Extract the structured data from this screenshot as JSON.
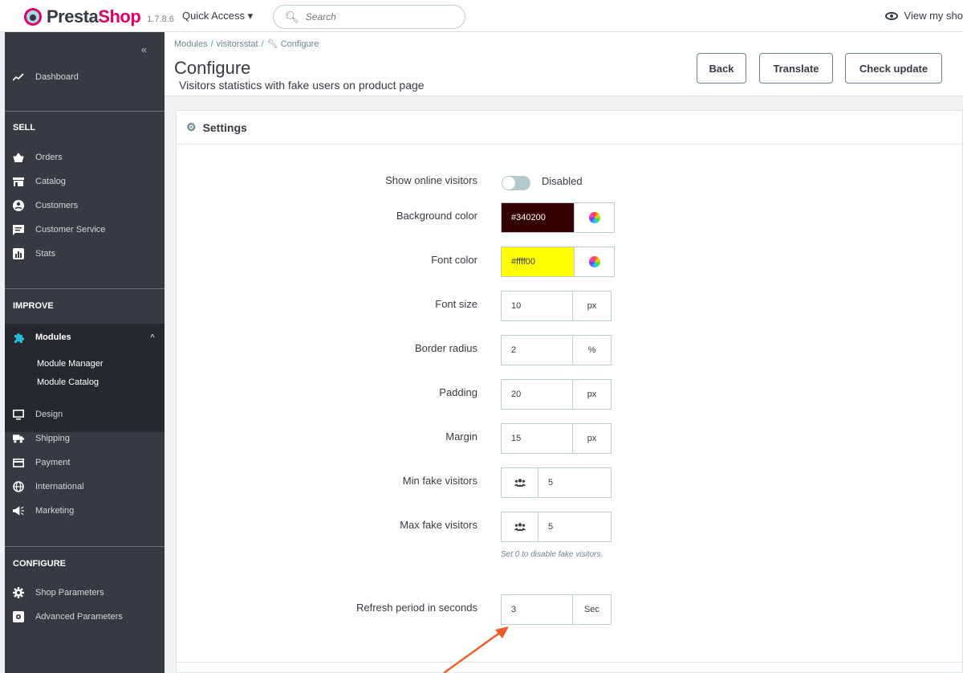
{
  "header": {
    "logo_text_a": "Presta",
    "logo_text_b": "Shop",
    "version": "1.7.8.6",
    "quick_access": "Quick Access ▾",
    "search_placeholder": "Search",
    "view_shop": "View my sho"
  },
  "sidebar": {
    "collapse": "«",
    "dashboard": "Dashboard",
    "sections": {
      "sell": "SELL",
      "improve": "IMPROVE",
      "configure": "CONFIGURE"
    },
    "sell_items": [
      "Orders",
      "Catalog",
      "Customers",
      "Customer Service",
      "Stats"
    ],
    "modules": "Modules",
    "modules_sub": [
      "Module Manager",
      "Module Catalog"
    ],
    "improve_items": [
      "Design",
      "Shipping",
      "Payment",
      "International",
      "Marketing"
    ],
    "configure_items": [
      "Shop Parameters",
      "Advanced Parameters"
    ]
  },
  "page": {
    "breadcrumb": [
      "Modules",
      "visitorsstat",
      "Configure"
    ],
    "title": "Configure",
    "subtitle": "Visitors statistics with fake users on product page",
    "buttons": {
      "back": "Back",
      "translate": "Translate",
      "check_update": "Check update"
    }
  },
  "settings": {
    "title": "Settings",
    "show_online_visitors": {
      "label": "Show online visitors",
      "state": "Disabled"
    },
    "background_color": {
      "label": "Background color",
      "value": "#340200"
    },
    "font_color": {
      "label": "Font color",
      "value": "#ffff00"
    },
    "font_size": {
      "label": "Font size",
      "value": "10",
      "unit": "px"
    },
    "border_radius": {
      "label": "Border radius",
      "value": "2",
      "unit": "%"
    },
    "padding": {
      "label": "Padding",
      "value": "20",
      "unit": "px"
    },
    "margin": {
      "label": "Margin",
      "value": "15",
      "unit": "px"
    },
    "min_fake_visitors": {
      "label": "Min fake visitors",
      "value": "5"
    },
    "max_fake_visitors": {
      "label": "Max fake visitors",
      "value": "5",
      "help": "Set 0 to disable fake visitors."
    },
    "refresh_period": {
      "label": "Refresh period in seconds",
      "value": "3",
      "unit": "Sec"
    }
  },
  "colors": {
    "sidebar": "#363a41",
    "sidebar_active": "#25282d",
    "accent": "#25b9d7",
    "brand": "#df0067",
    "annotation_arrow": "#f05a28"
  }
}
